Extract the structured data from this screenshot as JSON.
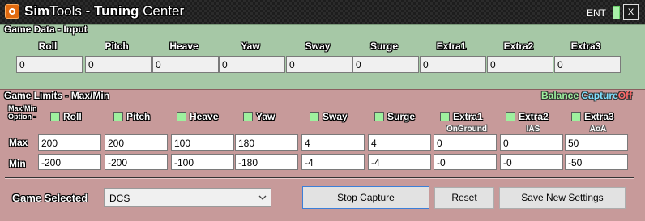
{
  "window": {
    "title_part1": "Sim",
    "title_part2": "Tools - ",
    "title_part3": "Tuning",
    "title_part4": " Center",
    "ent_label": "ENT",
    "close_label": "X"
  },
  "game_data": {
    "title": "Game Data - Input",
    "columns": [
      {
        "label": "Roll",
        "value": "0"
      },
      {
        "label": "Pitch",
        "value": "0"
      },
      {
        "label": "Heave",
        "value": "0"
      },
      {
        "label": "Yaw",
        "value": "0"
      },
      {
        "label": "Sway",
        "value": "0"
      },
      {
        "label": "Surge",
        "value": "0"
      },
      {
        "label": "Extra1",
        "value": "0"
      },
      {
        "label": "Extra2",
        "value": "0"
      },
      {
        "label": "Extra3",
        "value": "0"
      }
    ]
  },
  "game_limits": {
    "title": "Game Limits - Max/Min",
    "balance_label": "Balance",
    "capture_label": "Capture",
    "off_label": "Off",
    "option_label_line1": "Max/Min",
    "option_label_line2": "Option -",
    "max_label": "Max",
    "min_label": "Min",
    "columns": [
      {
        "label": "Roll",
        "sub": "",
        "max": "200",
        "min": "-200"
      },
      {
        "label": "Pitch",
        "sub": "",
        "max": "200",
        "min": "-200"
      },
      {
        "label": "Heave",
        "sub": "",
        "max": "100",
        "min": "-100"
      },
      {
        "label": "Yaw",
        "sub": "",
        "max": "180",
        "min": "-180"
      },
      {
        "label": "Sway",
        "sub": "",
        "max": "4",
        "min": "-4"
      },
      {
        "label": "Surge",
        "sub": "",
        "max": "4",
        "min": "-4"
      },
      {
        "label": "Extra1",
        "sub": "OnGround",
        "max": "0",
        "min": "-0"
      },
      {
        "label": "Extra2",
        "sub": "IAS",
        "max": "0",
        "min": "-0"
      },
      {
        "label": "Extra3",
        "sub": "AoA",
        "max": "50",
        "min": "-50"
      }
    ],
    "colors": {
      "balance": "#9ef09e",
      "capture": "#7fe0ff",
      "off": "#ff6b6b"
    }
  },
  "footer": {
    "game_selected_label": "Game Selected",
    "game_value": "DCS",
    "stop_capture": "Stop Capture",
    "reset": "Reset",
    "save": "Save New Settings"
  }
}
